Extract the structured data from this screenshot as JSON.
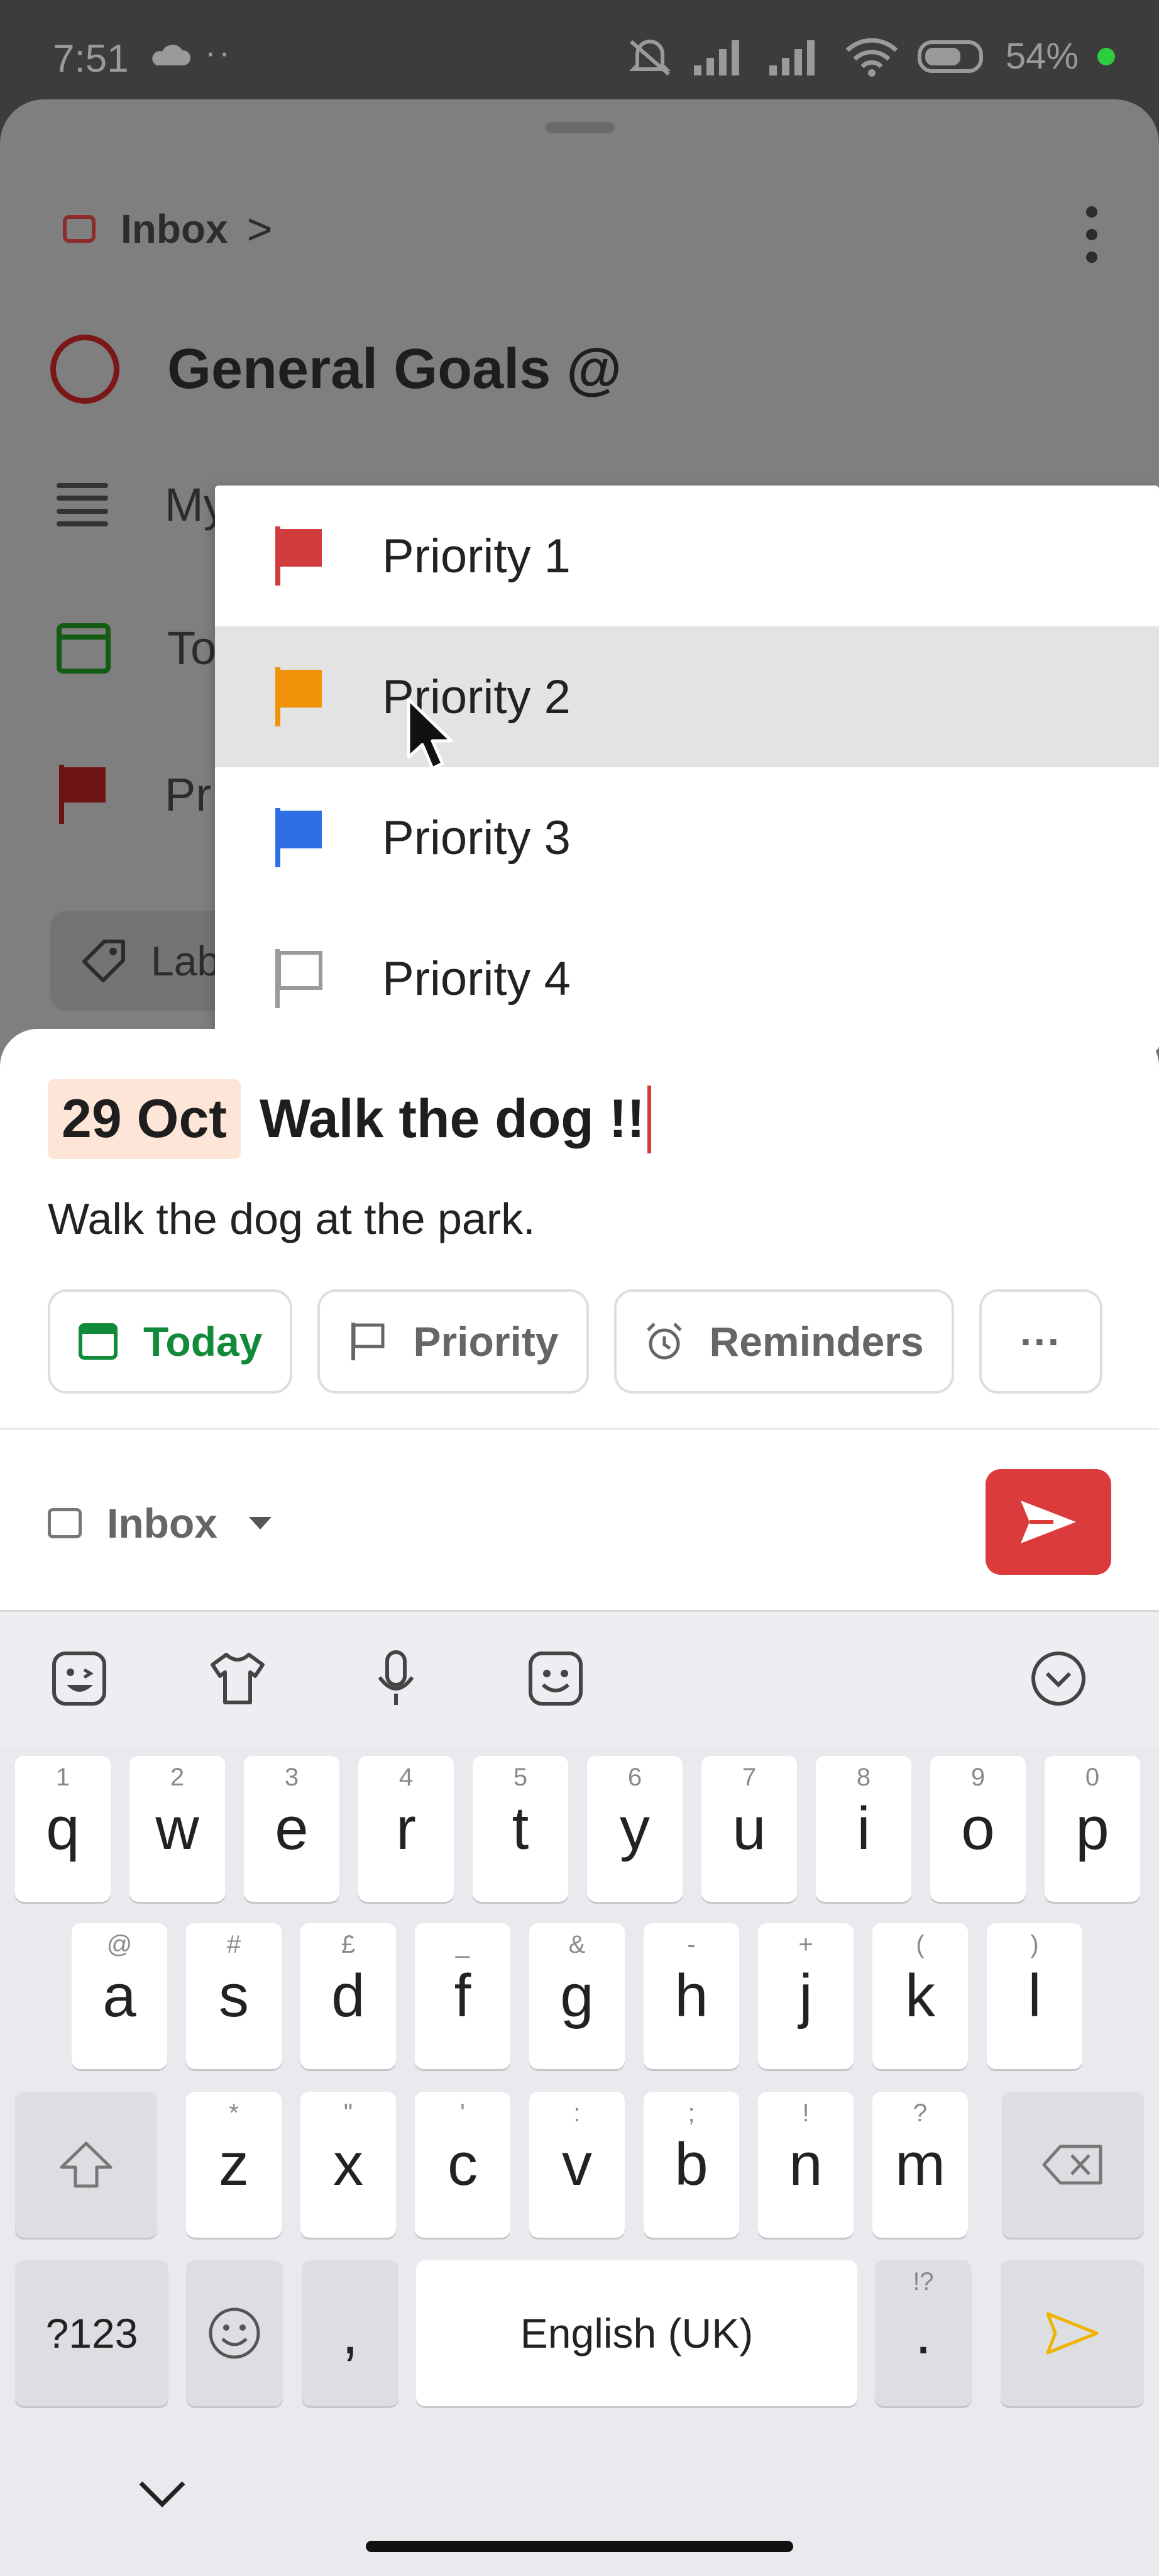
{
  "status_bar": {
    "time": "7:51",
    "dots": "··",
    "battery": "54%"
  },
  "sheet": {
    "breadcrumb": "Inbox",
    "breadcrumb_chevron": ">",
    "task_title": "General Goals @",
    "desc_row": "My",
    "date_row": "To",
    "priority_row": "Pr",
    "labels_chip": "Lab"
  },
  "priority_menu": {
    "items": [
      {
        "label": "Priority 1",
        "color": "#d13b3b"
      },
      {
        "label": "Priority 2",
        "color": "#f0920a"
      },
      {
        "label": "Priority 3",
        "color": "#2e6fe6"
      },
      {
        "label": "Priority 4",
        "color": "#9a9a9a"
      }
    ],
    "highlighted": "Priority 2"
  },
  "quick_add": {
    "date_chip": "29 Oct",
    "title": "Walk the dog !!",
    "description": "Walk the dog at the park.",
    "chips": {
      "today": "Today",
      "priority": "Priority",
      "reminders": "Reminders",
      "more": "···"
    },
    "project": "Inbox",
    "accent": "#dc3b3b"
  },
  "keyboard": {
    "row1": [
      {
        "k": "q",
        "h": "1"
      },
      {
        "k": "w",
        "h": "2"
      },
      {
        "k": "e",
        "h": "3"
      },
      {
        "k": "r",
        "h": "4"
      },
      {
        "k": "t",
        "h": "5"
      },
      {
        "k": "y",
        "h": "6"
      },
      {
        "k": "u",
        "h": "7"
      },
      {
        "k": "i",
        "h": "8"
      },
      {
        "k": "o",
        "h": "9"
      },
      {
        "k": "p",
        "h": "0"
      }
    ],
    "row2": [
      {
        "k": "a",
        "h": "@"
      },
      {
        "k": "s",
        "h": "#"
      },
      {
        "k": "d",
        "h": "£"
      },
      {
        "k": "f",
        "h": "_"
      },
      {
        "k": "g",
        "h": "&"
      },
      {
        "k": "h",
        "h": "-"
      },
      {
        "k": "j",
        "h": "+"
      },
      {
        "k": "k",
        "h": "("
      },
      {
        "k": "l",
        "h": ")"
      }
    ],
    "row3": [
      {
        "k": "z",
        "h": "*"
      },
      {
        "k": "x",
        "h": "\""
      },
      {
        "k": "c",
        "h": "'"
      },
      {
        "k": "v",
        "h": ":"
      },
      {
        "k": "b",
        "h": ";"
      },
      {
        "k": "n",
        "h": "!"
      },
      {
        "k": "m",
        "h": "?"
      }
    ],
    "symbols": "?123",
    "comma": ",",
    "space": "English (UK)",
    "period": ".",
    "period_hint": "!?"
  }
}
